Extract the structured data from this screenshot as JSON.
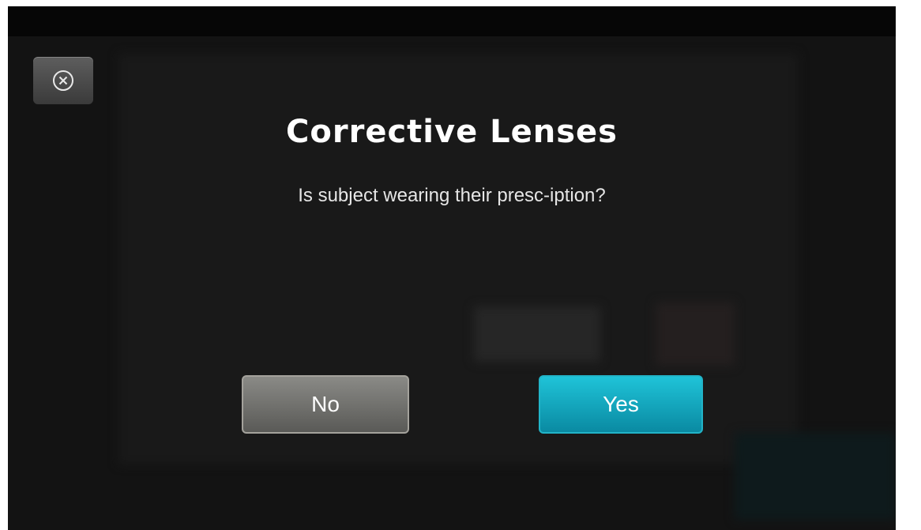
{
  "dialog": {
    "title": "Corrective Lenses",
    "question": "Is subject wearing their presc-iption?",
    "no_label": "No",
    "yes_label": "Yes"
  },
  "icons": {
    "close": "close-circle-icon"
  },
  "colors": {
    "background": "#131313",
    "yes_button": "#12a8c0",
    "no_button": "#73736f",
    "title_text": "#ffffff"
  }
}
